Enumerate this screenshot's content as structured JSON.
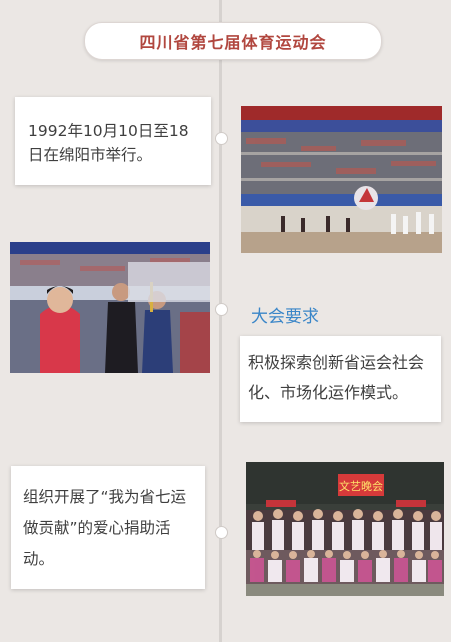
{
  "title": "四川省第七届体育运动会",
  "event1": {
    "text": "1992年10月10日至18日在绵阳市举行。"
  },
  "requirements": {
    "heading": "大会要求",
    "text": "积极探索创新省运会社会化、市场化运作模式。"
  },
  "event2": {
    "text": "组织开展了“我为省七运做贡献”的爱心捐助活动。"
  },
  "photo_banner_text": "文艺晚会"
}
